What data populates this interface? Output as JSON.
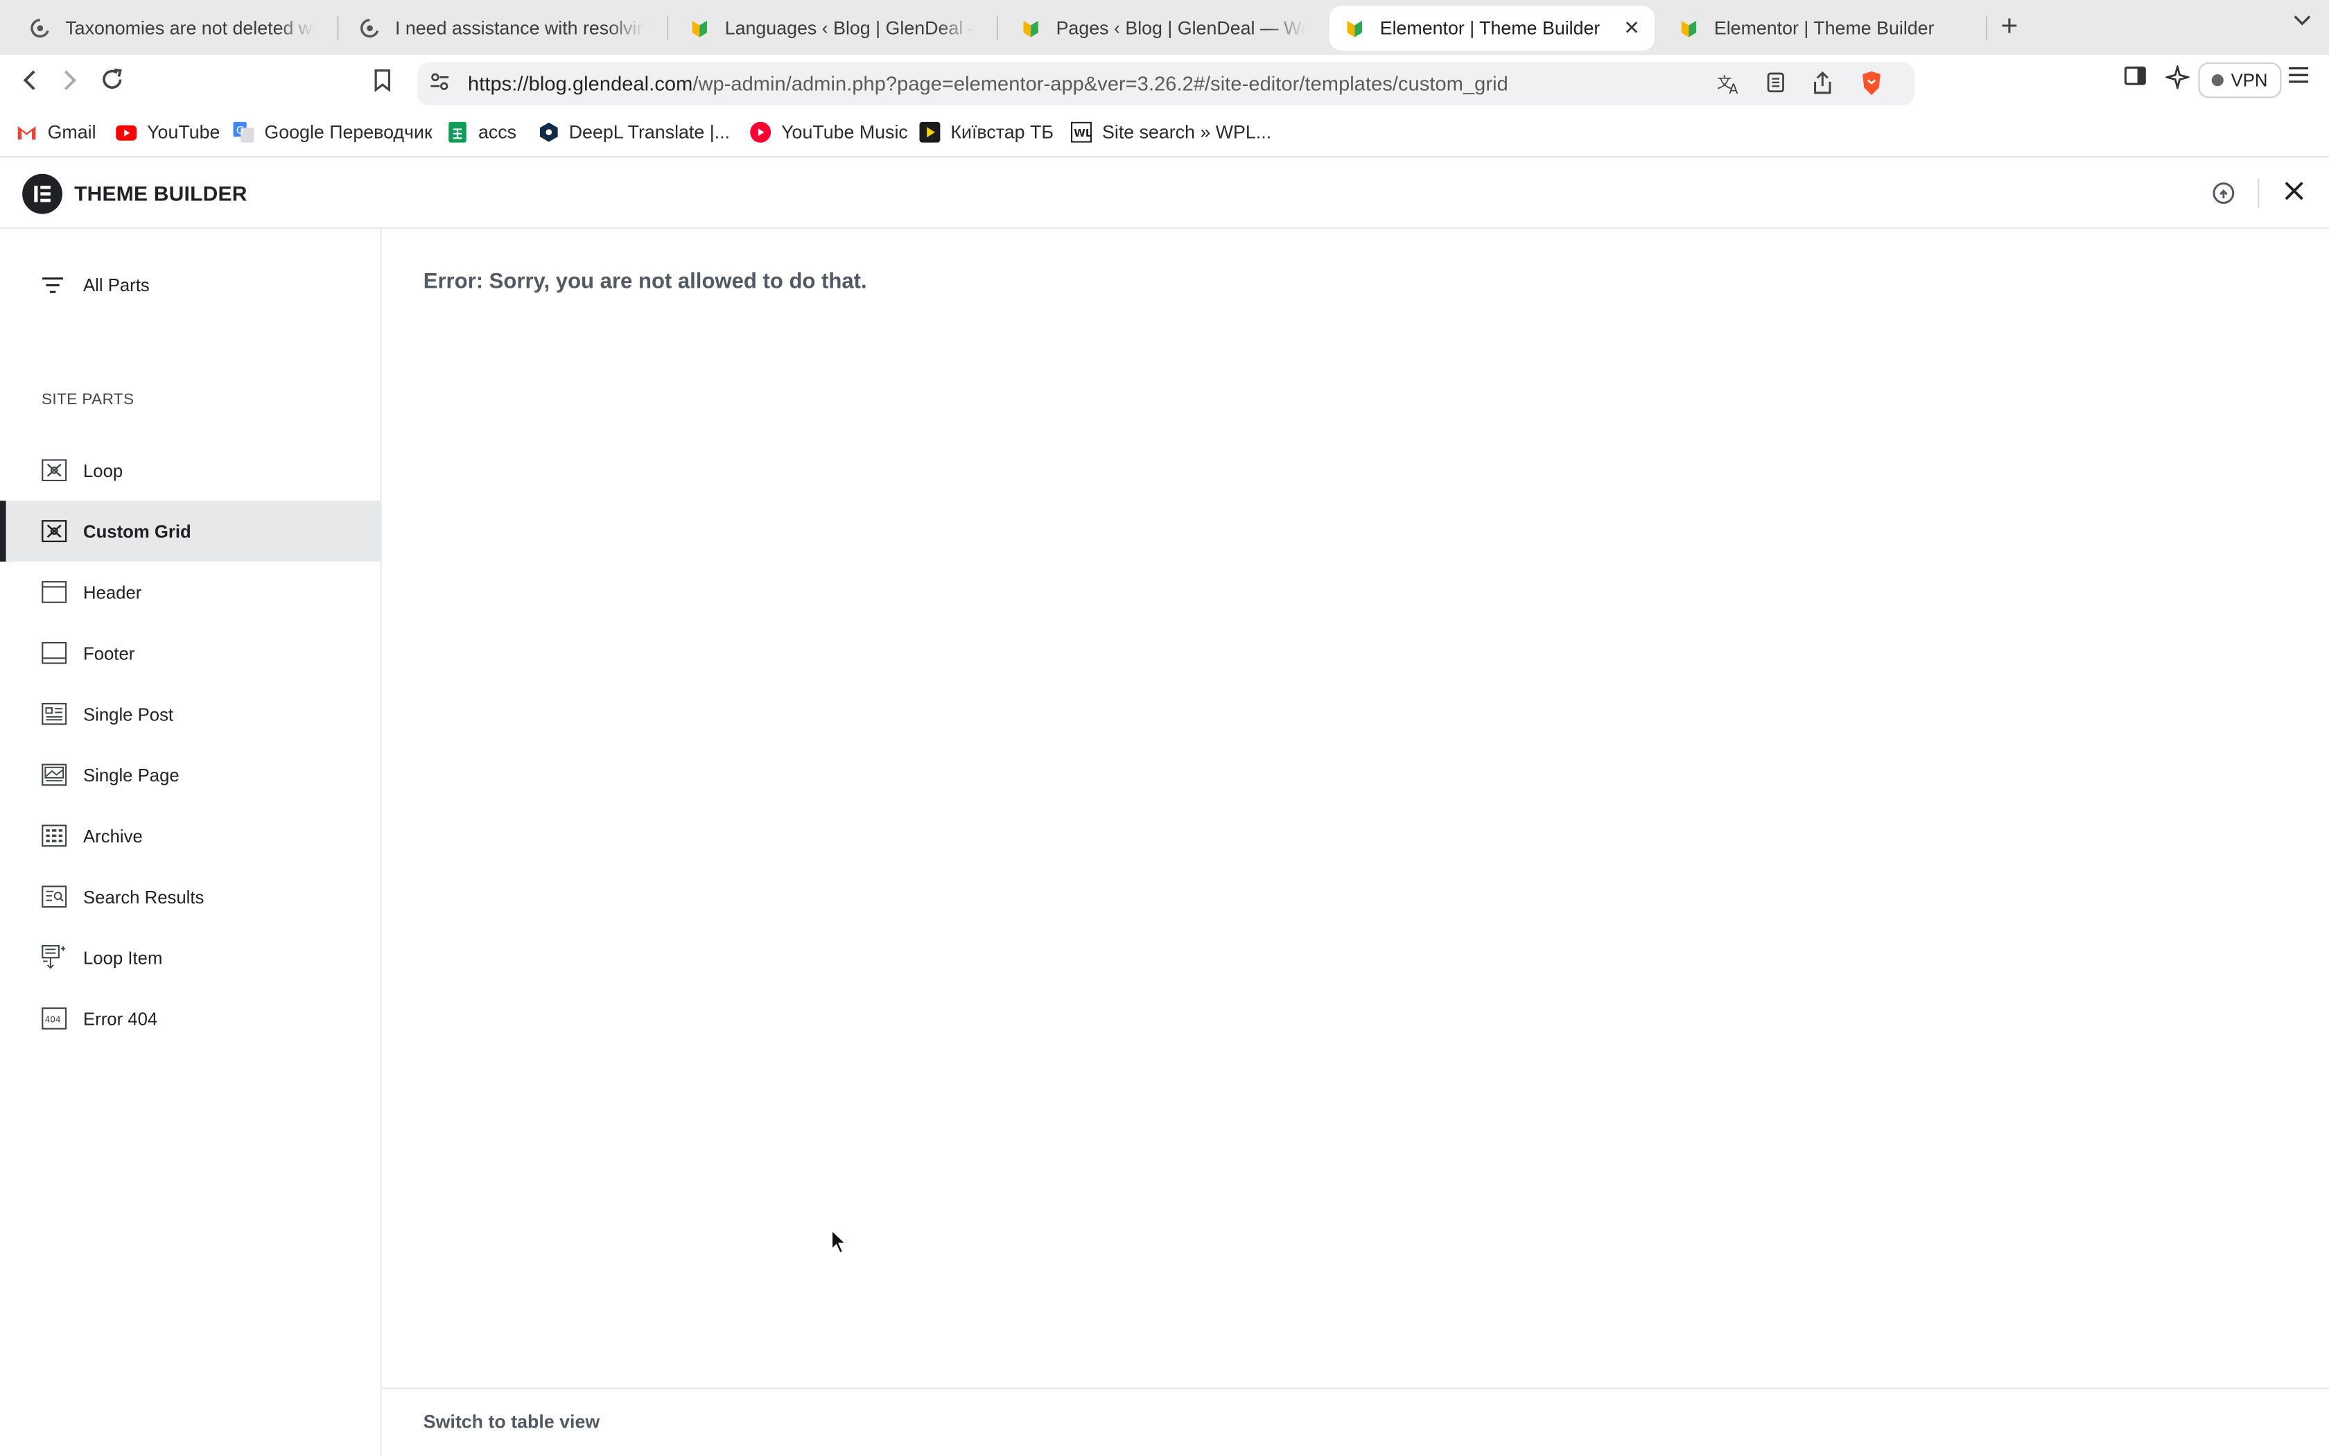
{
  "browser": {
    "tabs": [
      {
        "title": "Taxonomies are not deleted with t",
        "icon": "support-icon"
      },
      {
        "title": "I need assistance with resolving i",
        "icon": "support-icon"
      },
      {
        "title": "Languages ‹ Blog | GlenDeal — W",
        "icon": "glendeal-icon"
      },
      {
        "title": "Pages ‹ Blog | GlenDeal — WordP",
        "icon": "glendeal-icon"
      },
      {
        "title": "Elementor | Theme Builder",
        "icon": "glendeal-icon",
        "active": true
      },
      {
        "title": "Elementor | Theme Builder",
        "icon": "glendeal-icon"
      }
    ],
    "url_host": "https://blog.glendeal.com",
    "url_path": "/wp-admin/admin.php?page=elementor-app&ver=3.26.2#/site-editor/templates/custom_grid",
    "vpn_label": "VPN",
    "bookmarks": [
      {
        "label": "Gmail",
        "icon": "gmail-icon"
      },
      {
        "label": "YouTube",
        "icon": "youtube-icon"
      },
      {
        "label": "Google Переводчик",
        "icon": "google-translate-icon"
      },
      {
        "label": "accs",
        "icon": "sheets-icon"
      },
      {
        "label": "DeepL Translate |...",
        "icon": "deepl-icon"
      },
      {
        "label": "YouTube Music",
        "icon": "youtube-music-icon"
      },
      {
        "label": "Київстар ТБ",
        "icon": "kyivstar-icon"
      },
      {
        "label": "Site search » WPL...",
        "icon": "wpl-icon"
      }
    ]
  },
  "header": {
    "title": "THEME BUILDER"
  },
  "sidebar": {
    "all_parts": "All Parts",
    "section_title": "SITE PARTS",
    "items": [
      {
        "label": "Loop",
        "icon": "loop-icon"
      },
      {
        "label": "Custom Grid",
        "icon": "custom-grid-icon",
        "active": true
      },
      {
        "label": "Header",
        "icon": "header-icon"
      },
      {
        "label": "Footer",
        "icon": "footer-icon"
      },
      {
        "label": "Single Post",
        "icon": "single-post-icon"
      },
      {
        "label": "Single Page",
        "icon": "single-page-icon"
      },
      {
        "label": "Archive",
        "icon": "archive-icon"
      },
      {
        "label": "Search Results",
        "icon": "search-results-icon"
      },
      {
        "label": "Loop Item",
        "icon": "loop-item-icon"
      },
      {
        "label": "Error 404",
        "icon": "error-404-icon"
      }
    ]
  },
  "main": {
    "error_text": "Error: Sorry, you are not allowed to do that.",
    "switch_view": "Switch to table view"
  },
  "colors": {
    "brand": "#1f2124",
    "active_bg": "#e6e8ea",
    "error_text": "#515962"
  }
}
